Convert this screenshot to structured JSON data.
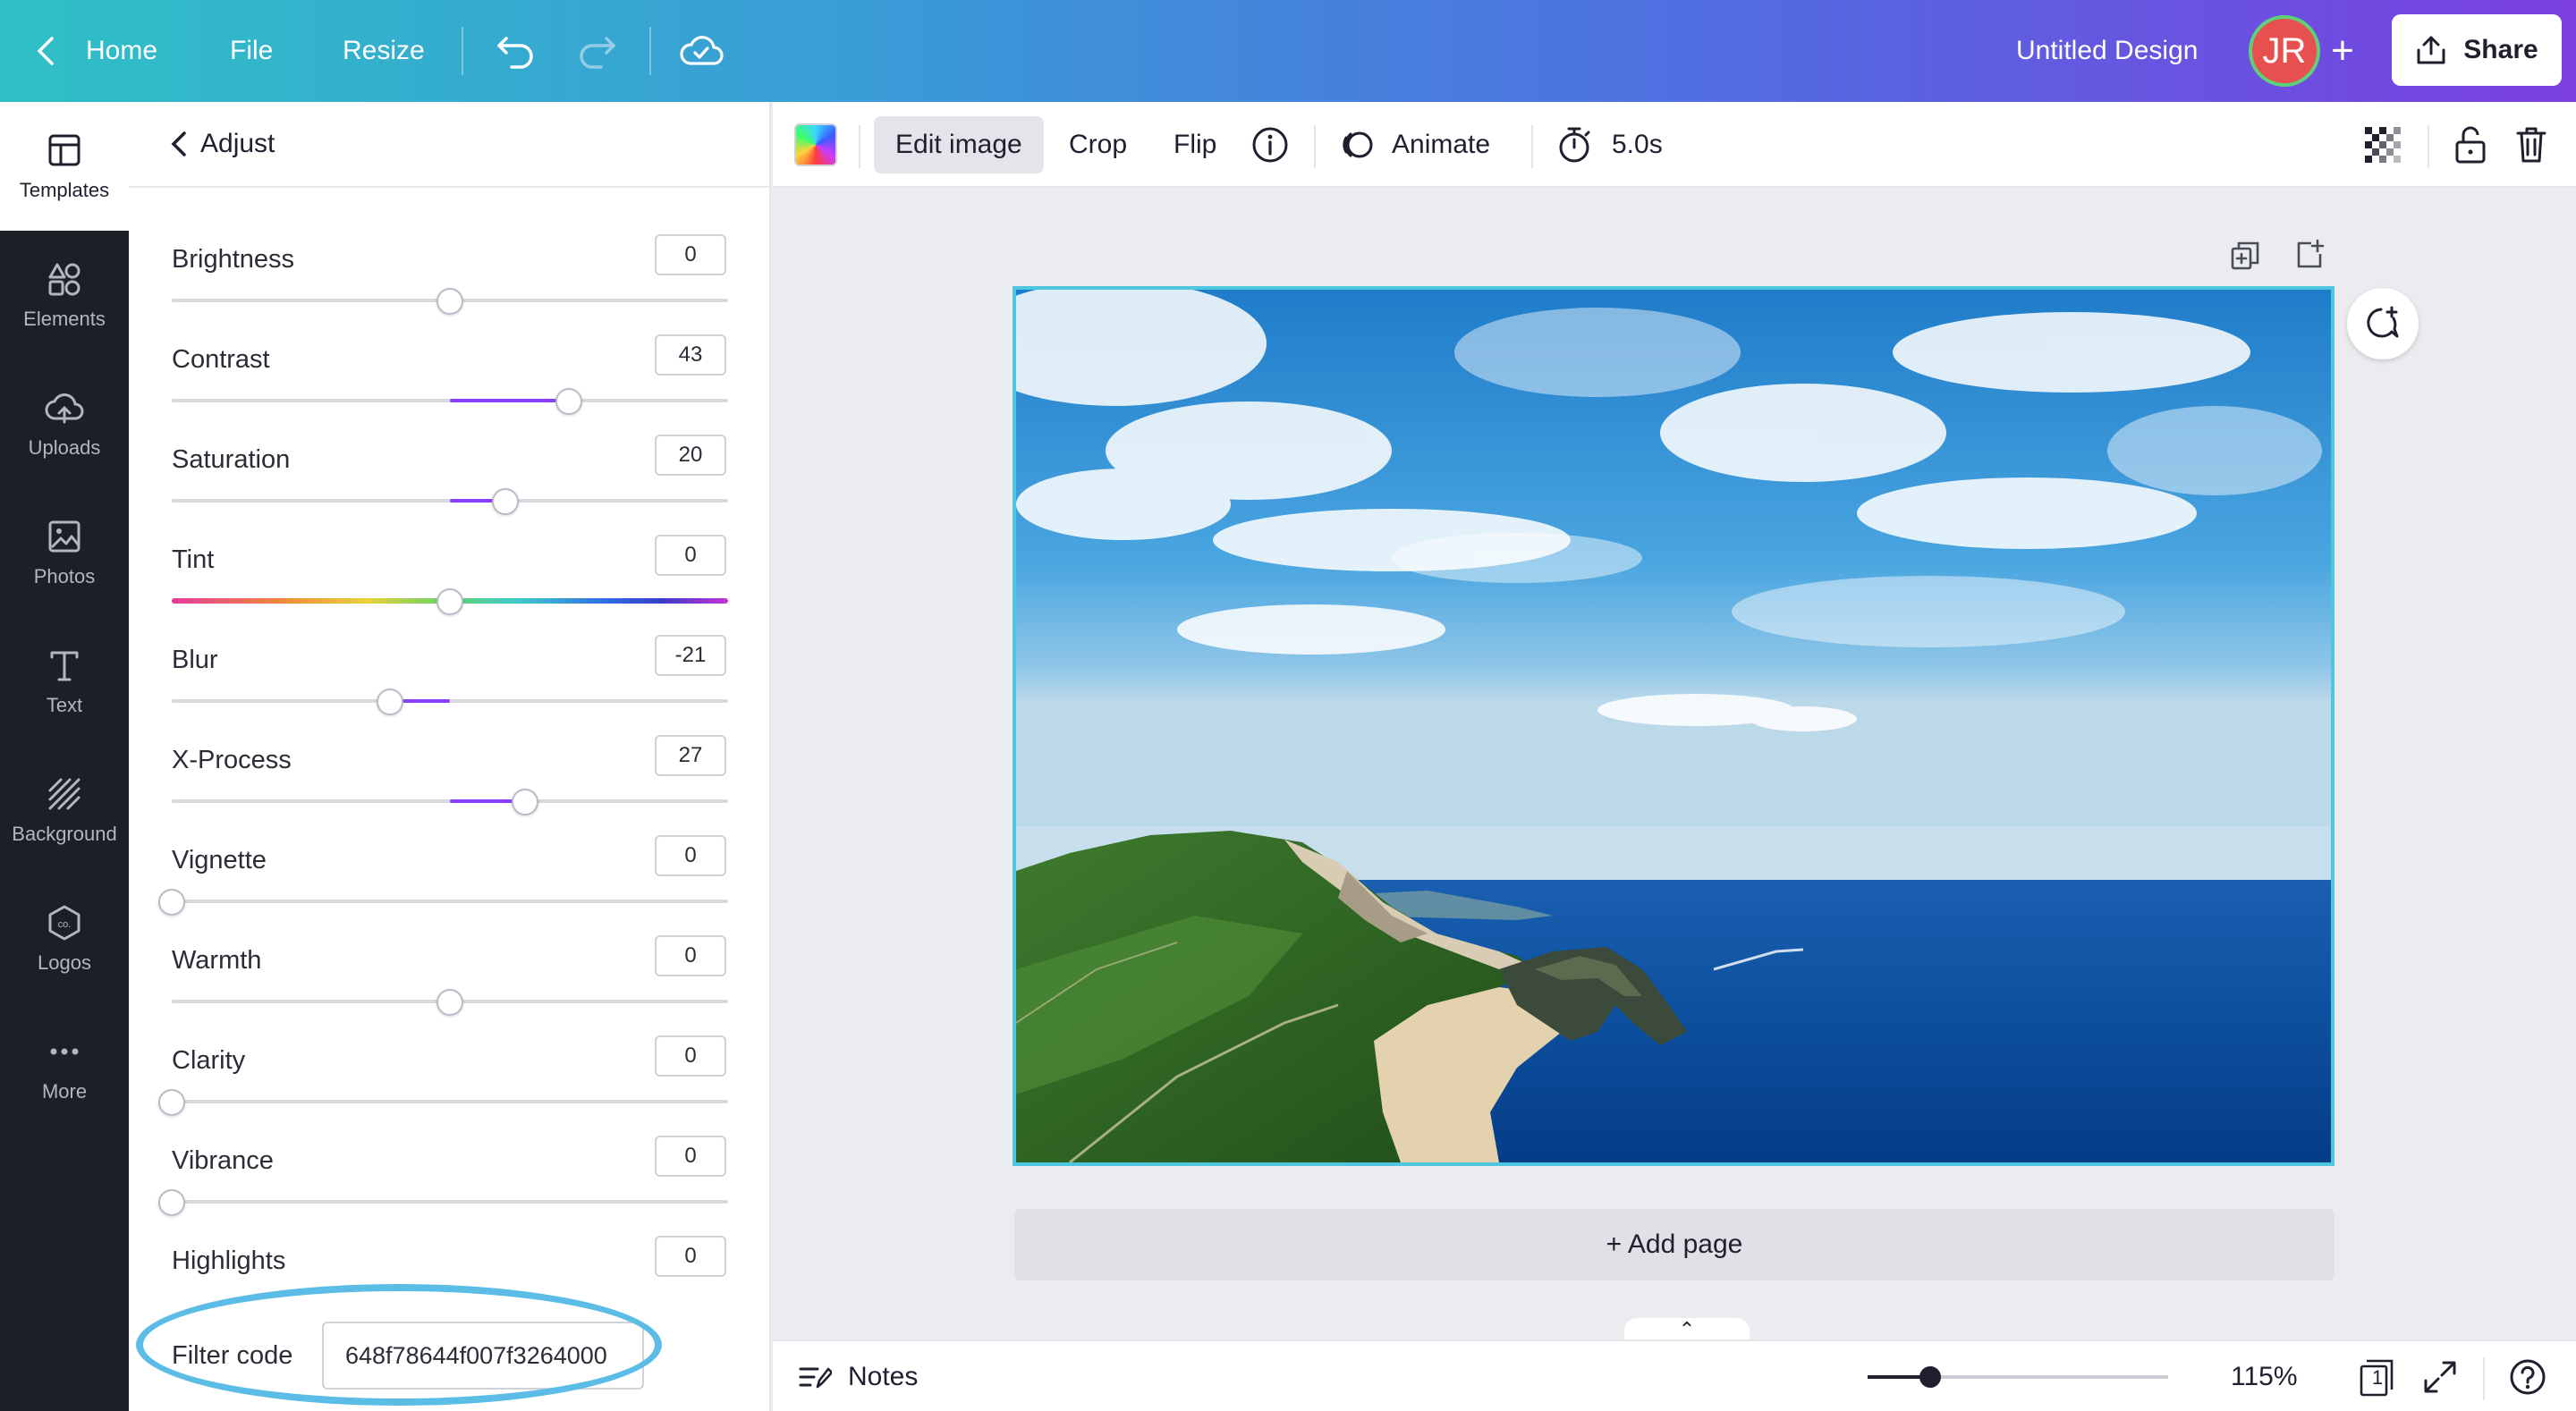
{
  "topbar": {
    "home_label": "Home",
    "file_label": "File",
    "resize_label": "Resize",
    "design_title": "Untitled Design",
    "avatar_initials": "JR",
    "share_label": "Share"
  },
  "leftnav": {
    "items": [
      {
        "label": "Templates",
        "icon": "templates-icon"
      },
      {
        "label": "Elements",
        "icon": "elements-icon"
      },
      {
        "label": "Uploads",
        "icon": "uploads-icon"
      },
      {
        "label": "Photos",
        "icon": "photos-icon"
      },
      {
        "label": "Text",
        "icon": "text-icon"
      },
      {
        "label": "Background",
        "icon": "background-icon"
      },
      {
        "label": "Logos",
        "icon": "logos-icon"
      },
      {
        "label": "More",
        "icon": "more-icon"
      }
    ]
  },
  "panel": {
    "title": "Adjust",
    "adjustments": [
      {
        "label": "Brightness",
        "value": "0"
      },
      {
        "label": "Contrast",
        "value": "43"
      },
      {
        "label": "Saturation",
        "value": "20"
      },
      {
        "label": "Tint",
        "value": "0"
      },
      {
        "label": "Blur",
        "value": "-21"
      },
      {
        "label": "X-Process",
        "value": "27"
      },
      {
        "label": "Vignette",
        "value": "0"
      },
      {
        "label": "Warmth",
        "value": "0"
      },
      {
        "label": "Clarity",
        "value": "0"
      },
      {
        "label": "Vibrance",
        "value": "0"
      },
      {
        "label": "Highlights",
        "value": "0"
      }
    ],
    "filter_label": "Filter code",
    "filter_value": "648f78644f007f3264000"
  },
  "toolbar": {
    "edit_image_label": "Edit image",
    "crop_label": "Crop",
    "flip_label": "Flip",
    "animate_label": "Animate",
    "duration_label": "5.0s"
  },
  "canvas": {
    "add_page_label": "+ Add page"
  },
  "bottombar": {
    "notes_label": "Notes",
    "zoom_label": "115%",
    "page_count": "1"
  },
  "colors": {
    "accent": "#8b3dff",
    "selection": "#4fc6e0",
    "highlight_ring": "#5bbde6"
  }
}
